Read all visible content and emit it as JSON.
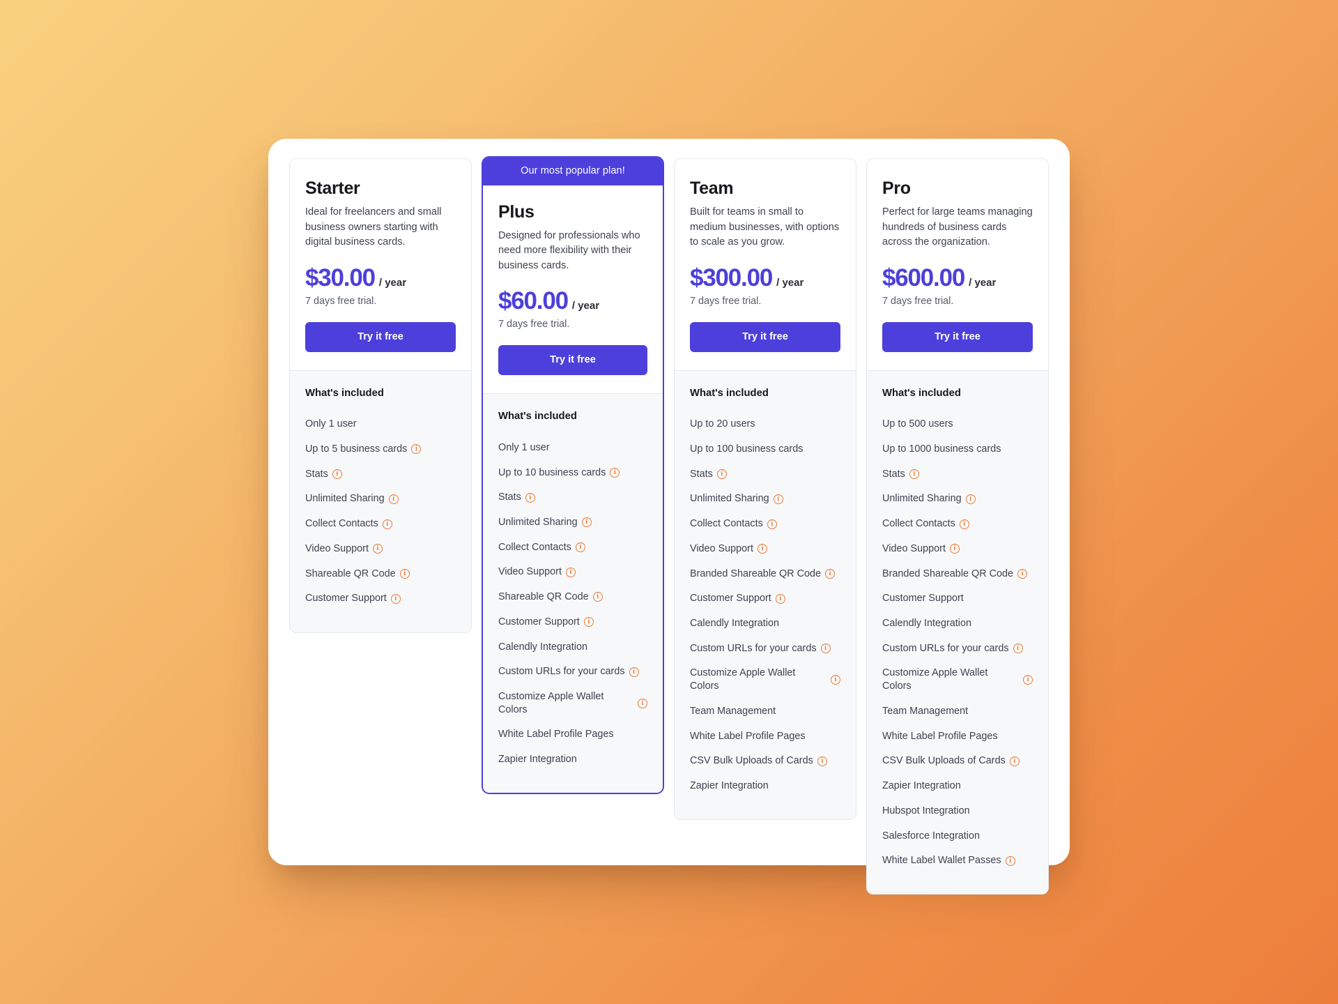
{
  "page": {
    "background_start": "#f8d17f",
    "background_end": "#ed7e3c",
    "accent_color": "#4d3fdb",
    "info_icon_color": "#ec7b35",
    "info_icon_glyph": "i"
  },
  "plans": [
    {
      "name": "Starter",
      "description": "Ideal for freelancers and small business owners starting with digital business cards.",
      "price": "$30.00",
      "period": "/ year",
      "trial": "7 days free trial.",
      "cta_label": "Try it free",
      "popular": false,
      "banner": "",
      "included_title": "What's included",
      "features": [
        {
          "label": "Only 1 user",
          "info": false
        },
        {
          "label": "Up to 5 business cards",
          "info": true
        },
        {
          "label": "Stats",
          "info": true
        },
        {
          "label": "Unlimited Sharing",
          "info": true
        },
        {
          "label": "Collect Contacts",
          "info": true
        },
        {
          "label": "Video Support",
          "info": true
        },
        {
          "label": "Shareable QR Code",
          "info": true
        },
        {
          "label": "Customer Support",
          "info": true
        }
      ]
    },
    {
      "name": "Plus",
      "description": "Designed for professionals who need more flexibility with their business cards.",
      "price": "$60.00",
      "period": "/ year",
      "trial": "7 days free trial.",
      "cta_label": "Try it free",
      "popular": true,
      "banner": "Our most popular plan!",
      "included_title": "What's included",
      "features": [
        {
          "label": "Only 1 user",
          "info": false
        },
        {
          "label": "Up to 10 business cards",
          "info": true
        },
        {
          "label": "Stats",
          "info": true
        },
        {
          "label": "Unlimited Sharing",
          "info": true
        },
        {
          "label": "Collect Contacts",
          "info": true
        },
        {
          "label": "Video Support",
          "info": true
        },
        {
          "label": "Shareable QR Code",
          "info": true
        },
        {
          "label": "Customer Support",
          "info": true
        },
        {
          "label": "Calendly Integration",
          "info": false
        },
        {
          "label": "Custom URLs for your cards",
          "info": true
        },
        {
          "label": "Customize Apple Wallet Colors",
          "info": true
        },
        {
          "label": "White Label Profile Pages",
          "info": false
        },
        {
          "label": "Zapier Integration",
          "info": false
        }
      ]
    },
    {
      "name": "Team",
      "description": "Built for teams in small to medium businesses, with options to scale as you grow.",
      "price": "$300.00",
      "period": "/ year",
      "trial": "7 days free trial.",
      "cta_label": "Try it free",
      "popular": false,
      "banner": "",
      "included_title": "What's included",
      "features": [
        {
          "label": "Up to 20 users",
          "info": false
        },
        {
          "label": "Up to 100 business cards",
          "info": false
        },
        {
          "label": "Stats",
          "info": true
        },
        {
          "label": "Unlimited Sharing",
          "info": true
        },
        {
          "label": "Collect Contacts",
          "info": true
        },
        {
          "label": "Video Support",
          "info": true
        },
        {
          "label": "Branded Shareable QR Code",
          "info": true
        },
        {
          "label": "Customer Support",
          "info": true
        },
        {
          "label": "Calendly Integration",
          "info": false
        },
        {
          "label": "Custom URLs for your cards",
          "info": true
        },
        {
          "label": "Customize Apple Wallet Colors",
          "info": true
        },
        {
          "label": "Team Management",
          "info": false
        },
        {
          "label": "White Label Profile Pages",
          "info": false
        },
        {
          "label": "CSV Bulk Uploads of Cards",
          "info": true
        },
        {
          "label": "Zapier Integration",
          "info": false
        }
      ]
    },
    {
      "name": "Pro",
      "description": "Perfect for large teams managing hundreds of business cards across the organization.",
      "price": "$600.00",
      "period": "/ year",
      "trial": "7 days free trial.",
      "cta_label": "Try it free",
      "popular": false,
      "banner": "",
      "included_title": "What's included",
      "features": [
        {
          "label": "Up to 500 users",
          "info": false
        },
        {
          "label": "Up to 1000 business cards",
          "info": false
        },
        {
          "label": "Stats",
          "info": true
        },
        {
          "label": "Unlimited Sharing",
          "info": true
        },
        {
          "label": "Collect Contacts",
          "info": true
        },
        {
          "label": "Video Support",
          "info": true
        },
        {
          "label": "Branded Shareable QR Code",
          "info": true
        },
        {
          "label": "Customer Support",
          "info": false
        },
        {
          "label": "Calendly Integration",
          "info": false
        },
        {
          "label": "Custom URLs for your cards",
          "info": true
        },
        {
          "label": "Customize Apple Wallet Colors",
          "info": true
        },
        {
          "label": "Team Management",
          "info": false
        },
        {
          "label": "White Label Profile Pages",
          "info": false
        },
        {
          "label": "CSV Bulk Uploads of Cards",
          "info": true
        },
        {
          "label": "Zapier Integration",
          "info": false
        },
        {
          "label": "Hubspot Integration",
          "info": false
        },
        {
          "label": "Salesforce Integration",
          "info": false
        },
        {
          "label": "White Label Wallet Passes",
          "info": true
        }
      ]
    }
  ]
}
